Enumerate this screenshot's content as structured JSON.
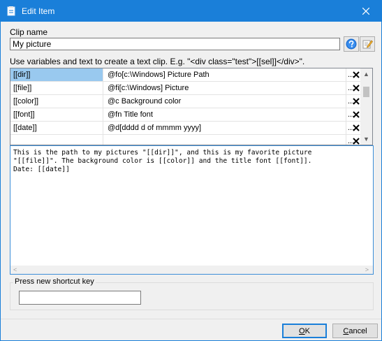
{
  "window": {
    "title": "Edit Item"
  },
  "clip_name": {
    "label": "Clip name",
    "value": "My picture"
  },
  "hint": "Use variables and text to create a text clip. E.g. \"<div class=\"test\">[[sel]]</div>\".",
  "variables": [
    {
      "name": "[[dir]]",
      "value": "@fo[c:\\Windows] Picture Path",
      "more": "...",
      "selected": true
    },
    {
      "name": "[[file]]",
      "value": "@fi[c:\\Windows] Picture",
      "more": "..."
    },
    {
      "name": "[[color]]",
      "value": "@c Background color",
      "more": "..."
    },
    {
      "name": "[[font]]",
      "value": "@fn Title font",
      "more": "..."
    },
    {
      "name": "[[date]]",
      "value": "@d[dddd d of mmmm yyyy]",
      "more": "..."
    },
    {
      "name": "",
      "value": "",
      "more": "..."
    }
  ],
  "template_text": "This is the path to my pictures \"[[dir]]\", and this is my favorite picture\n\"[[file]]\". The background color is [[color]] and the title font [[font]].\nDate: [[date]]",
  "shortcut": {
    "label": "Press new shortcut key",
    "value": ""
  },
  "buttons": {
    "ok_prefix": "",
    "ok_underlined": "O",
    "ok_rest": "K",
    "cancel_prefix": "",
    "cancel_underlined": "C",
    "cancel_rest": "ancel"
  },
  "colors": {
    "titlebar": "#1a7fd9",
    "selection": "#99c9ef",
    "editor_border": "#3c8ed8"
  },
  "icons": {
    "help": "help-icon",
    "edit": "edit-icon",
    "delete": "delete-icon",
    "close": "close-icon"
  }
}
